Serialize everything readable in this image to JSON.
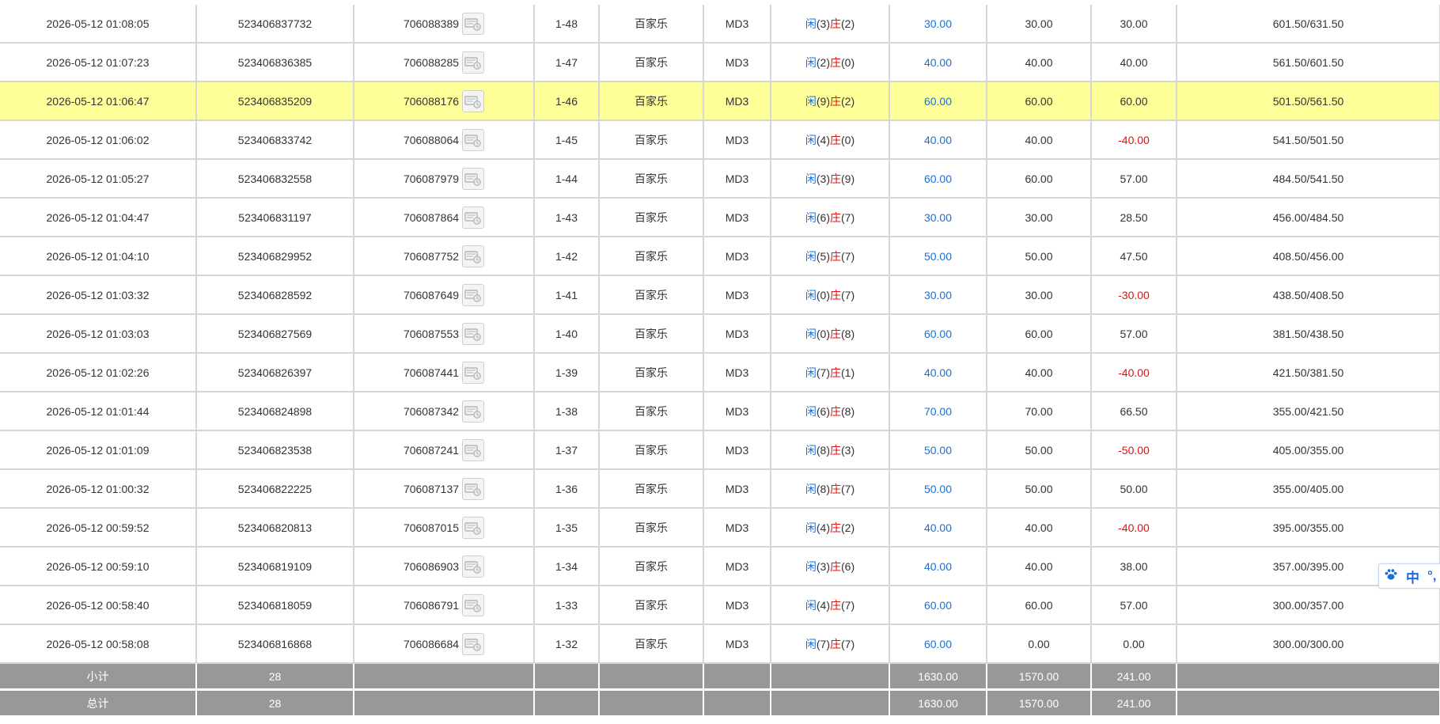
{
  "rows": [
    {
      "time": "2026-05-12 01:08:05",
      "order_no": "523406837732",
      "round_id": "706088389",
      "shoe": "1-48",
      "game": "百家乐",
      "table": "MD3",
      "r1_label": "闲",
      "r1_val": "(3)",
      "r2_label": "庄",
      "r2_val": "(2)",
      "bet": "30.00",
      "valid": "30.00",
      "win": "30.00",
      "balance": "601.50/631.50",
      "highlight": false,
      "win_negative": false
    },
    {
      "time": "2026-05-12 01:07:23",
      "order_no": "523406836385",
      "round_id": "706088285",
      "shoe": "1-47",
      "game": "百家乐",
      "table": "MD3",
      "r1_label": "闲",
      "r1_val": "(2)",
      "r2_label": "庄",
      "r2_val": "(0)",
      "bet": "40.00",
      "valid": "40.00",
      "win": "40.00",
      "balance": "561.50/601.50",
      "highlight": false,
      "win_negative": false
    },
    {
      "time": "2026-05-12 01:06:47",
      "order_no": "523406835209",
      "round_id": "706088176",
      "shoe": "1-46",
      "game": "百家乐",
      "table": "MD3",
      "r1_label": "闲",
      "r1_val": "(9)",
      "r2_label": "庄",
      "r2_val": "(2)",
      "bet": "60.00",
      "valid": "60.00",
      "win": "60.00",
      "balance": "501.50/561.50",
      "highlight": true,
      "win_negative": false
    },
    {
      "time": "2026-05-12 01:06:02",
      "order_no": "523406833742",
      "round_id": "706088064",
      "shoe": "1-45",
      "game": "百家乐",
      "table": "MD3",
      "r1_label": "闲",
      "r1_val": "(4)",
      "r2_label": "庄",
      "r2_val": "(0)",
      "bet": "40.00",
      "valid": "40.00",
      "win": "-40.00",
      "balance": "541.50/501.50",
      "highlight": false,
      "win_negative": true
    },
    {
      "time": "2026-05-12 01:05:27",
      "order_no": "523406832558",
      "round_id": "706087979",
      "shoe": "1-44",
      "game": "百家乐",
      "table": "MD3",
      "r1_label": "闲",
      "r1_val": "(3)",
      "r2_label": "庄",
      "r2_val": "(9)",
      "bet": "60.00",
      "valid": "60.00",
      "win": "57.00",
      "balance": "484.50/541.50",
      "highlight": false,
      "win_negative": false
    },
    {
      "time": "2026-05-12 01:04:47",
      "order_no": "523406831197",
      "round_id": "706087864",
      "shoe": "1-43",
      "game": "百家乐",
      "table": "MD3",
      "r1_label": "闲",
      "r1_val": "(6)",
      "r2_label": "庄",
      "r2_val": "(7)",
      "bet": "30.00",
      "valid": "30.00",
      "win": "28.50",
      "balance": "456.00/484.50",
      "highlight": false,
      "win_negative": false
    },
    {
      "time": "2026-05-12 01:04:10",
      "order_no": "523406829952",
      "round_id": "706087752",
      "shoe": "1-42",
      "game": "百家乐",
      "table": "MD3",
      "r1_label": "闲",
      "r1_val": "(5)",
      "r2_label": "庄",
      "r2_val": "(7)",
      "bet": "50.00",
      "valid": "50.00",
      "win": "47.50",
      "balance": "408.50/456.00",
      "highlight": false,
      "win_negative": false
    },
    {
      "time": "2026-05-12 01:03:32",
      "order_no": "523406828592",
      "round_id": "706087649",
      "shoe": "1-41",
      "game": "百家乐",
      "table": "MD3",
      "r1_label": "闲",
      "r1_val": "(0)",
      "r2_label": "庄",
      "r2_val": "(7)",
      "bet": "30.00",
      "valid": "30.00",
      "win": "-30.00",
      "balance": "438.50/408.50",
      "highlight": false,
      "win_negative": true
    },
    {
      "time": "2026-05-12 01:03:03",
      "order_no": "523406827569",
      "round_id": "706087553",
      "shoe": "1-40",
      "game": "百家乐",
      "table": "MD3",
      "r1_label": "闲",
      "r1_val": "(0)",
      "r2_label": "庄",
      "r2_val": "(8)",
      "bet": "60.00",
      "valid": "60.00",
      "win": "57.00",
      "balance": "381.50/438.50",
      "highlight": false,
      "win_negative": false
    },
    {
      "time": "2026-05-12 01:02:26",
      "order_no": "523406826397",
      "round_id": "706087441",
      "shoe": "1-39",
      "game": "百家乐",
      "table": "MD3",
      "r1_label": "闲",
      "r1_val": "(7)",
      "r2_label": "庄",
      "r2_val": "(1)",
      "bet": "40.00",
      "valid": "40.00",
      "win": "-40.00",
      "balance": "421.50/381.50",
      "highlight": false,
      "win_negative": true
    },
    {
      "time": "2026-05-12 01:01:44",
      "order_no": "523406824898",
      "round_id": "706087342",
      "shoe": "1-38",
      "game": "百家乐",
      "table": "MD3",
      "r1_label": "闲",
      "r1_val": "(6)",
      "r2_label": "庄",
      "r2_val": "(8)",
      "bet": "70.00",
      "valid": "70.00",
      "win": "66.50",
      "balance": "355.00/421.50",
      "highlight": false,
      "win_negative": false
    },
    {
      "time": "2026-05-12 01:01:09",
      "order_no": "523406823538",
      "round_id": "706087241",
      "shoe": "1-37",
      "game": "百家乐",
      "table": "MD3",
      "r1_label": "闲",
      "r1_val": "(8)",
      "r2_label": "庄",
      "r2_val": "(3)",
      "bet": "50.00",
      "valid": "50.00",
      "win": "-50.00",
      "balance": "405.00/355.00",
      "highlight": false,
      "win_negative": true
    },
    {
      "time": "2026-05-12 01:00:32",
      "order_no": "523406822225",
      "round_id": "706087137",
      "shoe": "1-36",
      "game": "百家乐",
      "table": "MD3",
      "r1_label": "闲",
      "r1_val": "(8)",
      "r2_label": "庄",
      "r2_val": "(7)",
      "bet": "50.00",
      "valid": "50.00",
      "win": "50.00",
      "balance": "355.00/405.00",
      "highlight": false,
      "win_negative": false
    },
    {
      "time": "2026-05-12 00:59:52",
      "order_no": "523406820813",
      "round_id": "706087015",
      "shoe": "1-35",
      "game": "百家乐",
      "table": "MD3",
      "r1_label": "闲",
      "r1_val": "(4)",
      "r2_label": "庄",
      "r2_val": "(2)",
      "bet": "40.00",
      "valid": "40.00",
      "win": "-40.00",
      "balance": "395.00/355.00",
      "highlight": false,
      "win_negative": true
    },
    {
      "time": "2026-05-12 00:59:10",
      "order_no": "523406819109",
      "round_id": "706086903",
      "shoe": "1-34",
      "game": "百家乐",
      "table": "MD3",
      "r1_label": "闲",
      "r1_val": "(3)",
      "r2_label": "庄",
      "r2_val": "(6)",
      "bet": "40.00",
      "valid": "40.00",
      "win": "38.00",
      "balance": "357.00/395.00",
      "highlight": false,
      "win_negative": false
    },
    {
      "time": "2026-05-12 00:58:40",
      "order_no": "523406818059",
      "round_id": "706086791",
      "shoe": "1-33",
      "game": "百家乐",
      "table": "MD3",
      "r1_label": "闲",
      "r1_val": "(4)",
      "r2_label": "庄",
      "r2_val": "(7)",
      "bet": "60.00",
      "valid": "60.00",
      "win": "57.00",
      "balance": "300.00/357.00",
      "highlight": false,
      "win_negative": false
    },
    {
      "time": "2026-05-12 00:58:08",
      "order_no": "523406816868",
      "round_id": "706086684",
      "shoe": "1-32",
      "game": "百家乐",
      "table": "MD3",
      "r1_label": "闲",
      "r1_val": "(7)",
      "r2_label": "庄",
      "r2_val": "(7)",
      "bet": "60.00",
      "valid": "0.00",
      "win": "0.00",
      "balance": "300.00/300.00",
      "highlight": false,
      "win_negative": false
    }
  ],
  "totals": [
    {
      "label": "小计",
      "count": "28",
      "bet": "1630.00",
      "valid": "1570.00",
      "win": "241.00"
    },
    {
      "label": "总计",
      "count": "28",
      "bet": "1630.00",
      "valid": "1570.00",
      "win": "241.00"
    }
  ],
  "ime": {
    "icon": "paw-icon",
    "lang": "中",
    "punct": "°,"
  },
  "colors": {
    "highlight": "#ffff99",
    "blue": "#1a6fd6",
    "red": "#e01010",
    "total_bg": "#989898"
  }
}
